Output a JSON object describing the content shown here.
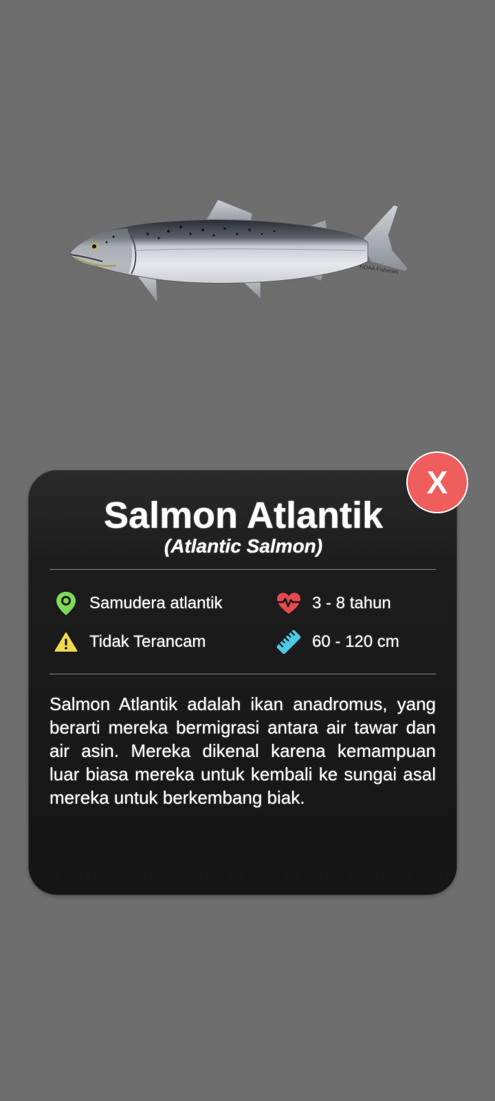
{
  "species": {
    "name": "Salmon Atlantik",
    "scientific_name": "(Atlantic Salmon)",
    "image_watermark": "NOAA Fisheries",
    "habitat": "Samudera atlantik",
    "lifespan": "3 - 8 tahun",
    "conservation_status": "Tidak Terancam",
    "length": "60 - 120 cm",
    "description": "Salmon Atlantik adalah ikan anadromus, yang berarti mereka bermigrasi antara air tawar dan air asin. Mereka dikenal karena kemampuan luar biasa mereka untuk kembali ke sungai asal mereka untuk berkembang biak."
  },
  "close_button": {
    "label": "X"
  },
  "icons": {
    "habitat": "map-pin-icon",
    "lifespan": "heart-pulse-icon",
    "status": "warning-icon",
    "length": "ruler-icon"
  },
  "colors": {
    "background": "#6e6e6e",
    "card": "#151515",
    "close_button": "#f05d5d",
    "pin": "#7ed957",
    "heart": "#e5484d",
    "warning": "#f0d84c",
    "ruler": "#4cc9e6"
  }
}
